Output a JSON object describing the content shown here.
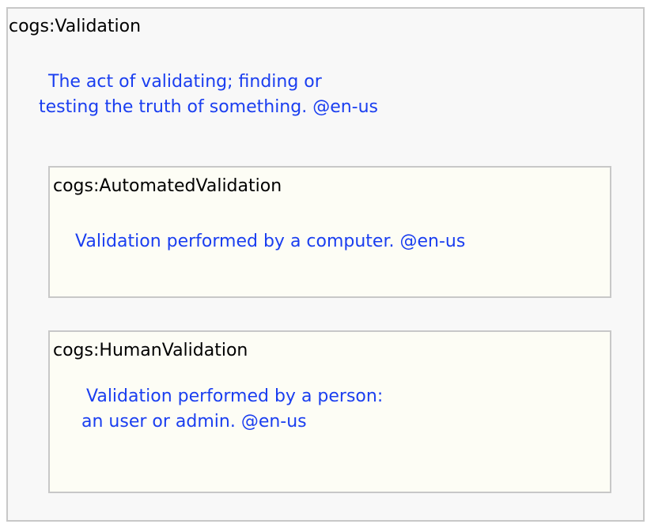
{
  "diagram": {
    "classes": [
      {
        "id": "validation",
        "name": "cogs:Validation",
        "comment_lines": [
          "The act of validating; finding or",
          "testing the truth of something. @en-us"
        ]
      },
      {
        "id": "automated",
        "name": "cogs:AutomatedValidation",
        "comment_lines": [
          "Validation performed by a computer. @en-us"
        ]
      },
      {
        "id": "human",
        "name": "cogs:HumanValidation",
        "comment_lines": [
          "Validation performed by a person:",
          "an user or admin. @en-us"
        ]
      }
    ],
    "colors": {
      "comment_text": "#1a3ef0",
      "class_text": "#000000",
      "outer_fill": "#f8f8f8",
      "inner_fill": "#fdfdf5",
      "border": "#c8c8c8"
    }
  }
}
